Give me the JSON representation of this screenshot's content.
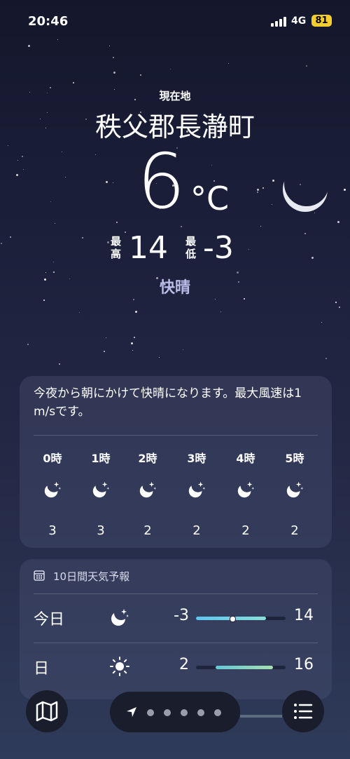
{
  "status_bar": {
    "time": "20:46",
    "network": "4G",
    "battery": "81"
  },
  "location": {
    "label": "現在地",
    "name": "秩父郡長瀞町"
  },
  "current": {
    "temperature": "6",
    "unit": "°C",
    "high_label": "最高",
    "high": "14",
    "low_label": "最低",
    "low": "-3",
    "condition": "快晴"
  },
  "hourly": {
    "summary": "今夜から朝にかけて快晴になります。最大風速は1 m/sです。",
    "items": [
      {
        "hour": "0時",
        "icon": "moon-stars-icon",
        "temp": "3"
      },
      {
        "hour": "1時",
        "icon": "moon-stars-icon",
        "temp": "3"
      },
      {
        "hour": "2時",
        "icon": "moon-stars-icon",
        "temp": "2"
      },
      {
        "hour": "3時",
        "icon": "moon-stars-icon",
        "temp": "2"
      },
      {
        "hour": "4時",
        "icon": "moon-stars-icon",
        "temp": "2"
      },
      {
        "hour": "5時",
        "icon": "moon-stars-icon",
        "temp": "2"
      }
    ]
  },
  "ten_day": {
    "title": "10日間天気予報",
    "days": [
      {
        "day": "今日",
        "icon": "moon-stars-icon",
        "low": "-3",
        "high": "14",
        "range_start": 0.0,
        "range_end": 0.78,
        "current": 0.4,
        "colors": [
          "#5fc4f2",
          "#88e0d8"
        ]
      },
      {
        "day": "日",
        "icon": "sun-icon",
        "low": "2",
        "high": "16",
        "range_start": 0.22,
        "range_end": 0.86,
        "colors": [
          "#62c9d6",
          "#a8e0b0"
        ]
      }
    ]
  },
  "bottom_bar": {
    "map": "map-icon",
    "location": "location-arrow-icon",
    "list": "list-icon",
    "page_dots": 5
  },
  "colors": {
    "condition": "#b9bde8",
    "battery": "#f5cd2f"
  }
}
